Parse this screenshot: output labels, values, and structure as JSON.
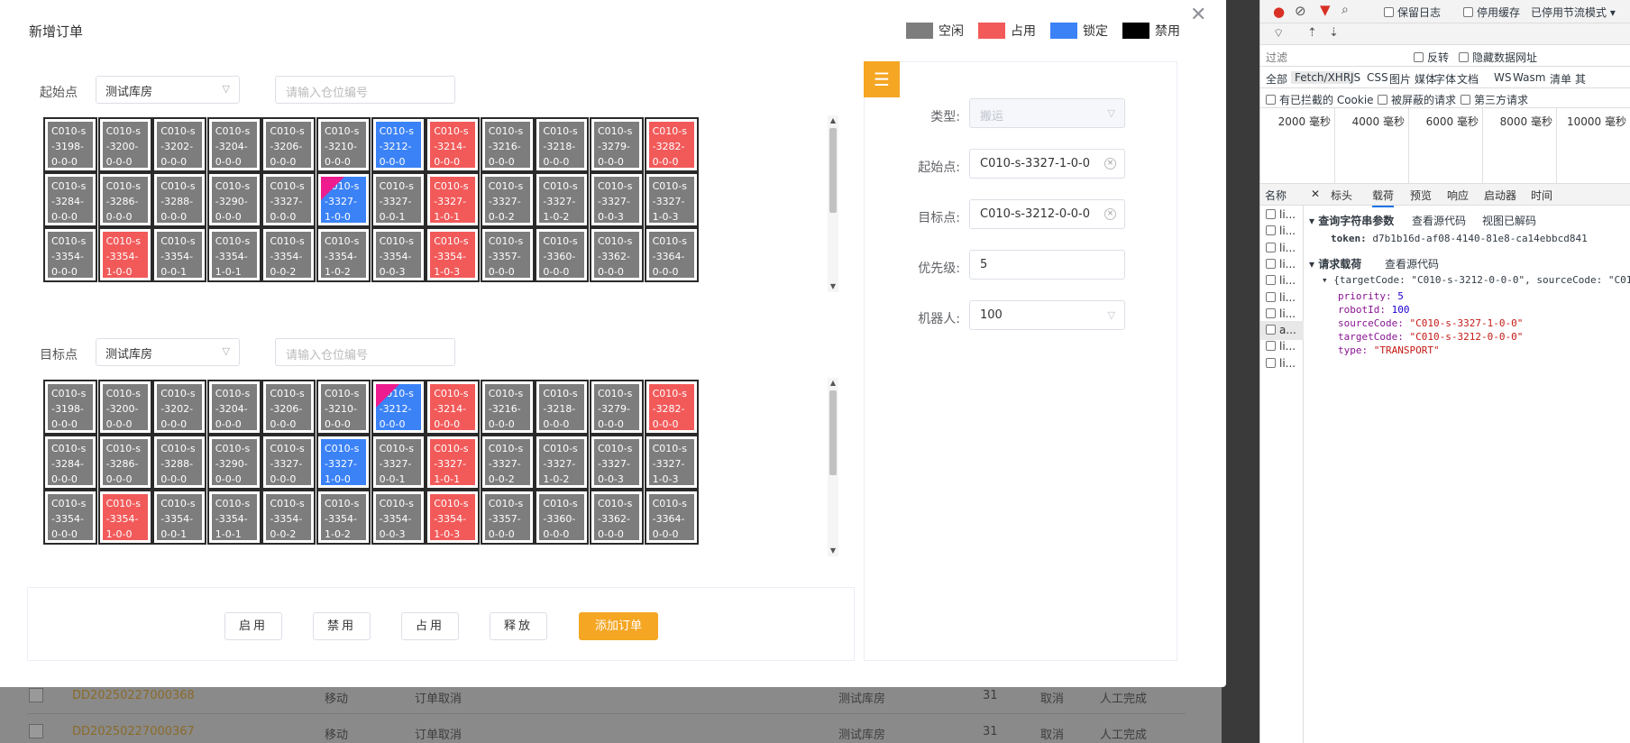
{
  "modal": {
    "title": "新增订单",
    "legend": [
      {
        "label": "空闲",
        "color": "#7d7d7d"
      },
      {
        "label": "占用",
        "color": "#f25a5a"
      },
      {
        "label": "锁定",
        "color": "#3b82f6"
      },
      {
        "label": "禁用",
        "color": "#000000"
      }
    ],
    "source": {
      "label": "起始点",
      "warehouse": "测试库房",
      "search_placeholder": "请输入仓位编号"
    },
    "target": {
      "label": "目标点",
      "warehouse": "测试库房",
      "search_placeholder": "请输入仓位编号"
    },
    "source_cells": [
      {
        "code": "C010-s-3198-0-0-0",
        "status": "free"
      },
      {
        "code": "C010-s-3200-0-0-0",
        "status": "free"
      },
      {
        "code": "C010-s-3202-0-0-0",
        "status": "free"
      },
      {
        "code": "C010-s-3204-0-0-0",
        "status": "free"
      },
      {
        "code": "C010-s-3206-0-0-0",
        "status": "free"
      },
      {
        "code": "C010-s-3210-0-0-0",
        "status": "free"
      },
      {
        "code": "C010-s-3212-0-0-0",
        "status": "lock"
      },
      {
        "code": "C010-s-3214-0-0-0",
        "status": "used"
      },
      {
        "code": "C010-s-3216-0-0-0",
        "status": "free"
      },
      {
        "code": "C010-s-3218-0-0-0",
        "status": "free"
      },
      {
        "code": "C010-s-3279-0-0-0",
        "status": "free"
      },
      {
        "code": "C010-s-3282-0-0-0",
        "status": "used"
      },
      {
        "code": "C010-s-3284-0-0-0",
        "status": "free"
      },
      {
        "code": "C010-s-3286-0-0-0",
        "status": "free"
      },
      {
        "code": "C010-s-3288-0-0-0",
        "status": "free"
      },
      {
        "code": "C010-s-3290-0-0-0",
        "status": "free"
      },
      {
        "code": "C010-s-3327-0-0-0",
        "status": "free"
      },
      {
        "code": "C010-s-3327-1-0-0",
        "status": "lock",
        "selected": true
      },
      {
        "code": "C010-s-3327-0-0-1",
        "status": "free"
      },
      {
        "code": "C010-s-3327-1-0-1",
        "status": "used"
      },
      {
        "code": "C010-s-3327-0-0-2",
        "status": "free"
      },
      {
        "code": "C010-s-3327-1-0-2",
        "status": "free"
      },
      {
        "code": "C010-s-3327-0-0-3",
        "status": "free"
      },
      {
        "code": "C010-s-3327-1-0-3",
        "status": "free"
      },
      {
        "code": "C010-s-3354-0-0-0",
        "status": "free"
      },
      {
        "code": "C010-s-3354-1-0-0",
        "status": "used"
      },
      {
        "code": "C010-s-3354-0-0-1",
        "status": "free"
      },
      {
        "code": "C010-s-3354-1-0-1",
        "status": "free"
      },
      {
        "code": "C010-s-3354-0-0-2",
        "status": "free"
      },
      {
        "code": "C010-s-3354-1-0-2",
        "status": "free"
      },
      {
        "code": "C010-s-3354-0-0-3",
        "status": "free"
      },
      {
        "code": "C010-s-3354-1-0-3",
        "status": "used"
      },
      {
        "code": "C010-s-3357-0-0-0",
        "status": "free"
      },
      {
        "code": "C010-s-3360-0-0-0",
        "status": "free"
      },
      {
        "code": "C010-s-3362-0-0-0",
        "status": "free"
      },
      {
        "code": "C010-s-3364-0-0-0",
        "status": "free"
      }
    ],
    "target_cells": [
      {
        "code": "C010-s-3198-0-0-0",
        "status": "free"
      },
      {
        "code": "C010-s-3200-0-0-0",
        "status": "free"
      },
      {
        "code": "C010-s-3202-0-0-0",
        "status": "free"
      },
      {
        "code": "C010-s-3204-0-0-0",
        "status": "free"
      },
      {
        "code": "C010-s-3206-0-0-0",
        "status": "free"
      },
      {
        "code": "C010-s-3210-0-0-0",
        "status": "free"
      },
      {
        "code": "C010-s-3212-0-0-0",
        "status": "lock",
        "selected": true
      },
      {
        "code": "C010-s-3214-0-0-0",
        "status": "used"
      },
      {
        "code": "C010-s-3216-0-0-0",
        "status": "free"
      },
      {
        "code": "C010-s-3218-0-0-0",
        "status": "free"
      },
      {
        "code": "C010-s-3279-0-0-0",
        "status": "free"
      },
      {
        "code": "C010-s-3282-0-0-0",
        "status": "used"
      },
      {
        "code": "C010-s-3284-0-0-0",
        "status": "free"
      },
      {
        "code": "C010-s-3286-0-0-0",
        "status": "free"
      },
      {
        "code": "C010-s-3288-0-0-0",
        "status": "free"
      },
      {
        "code": "C010-s-3290-0-0-0",
        "status": "free"
      },
      {
        "code": "C010-s-3327-0-0-0",
        "status": "free"
      },
      {
        "code": "C010-s-3327-1-0-0",
        "status": "lock"
      },
      {
        "code": "C010-s-3327-0-0-1",
        "status": "free"
      },
      {
        "code": "C010-s-3327-1-0-1",
        "status": "used"
      },
      {
        "code": "C010-s-3327-0-0-2",
        "status": "free"
      },
      {
        "code": "C010-s-3327-1-0-2",
        "status": "free"
      },
      {
        "code": "C010-s-3327-0-0-3",
        "status": "free"
      },
      {
        "code": "C010-s-3327-1-0-3",
        "status": "free"
      },
      {
        "code": "C010-s-3354-0-0-0",
        "status": "free"
      },
      {
        "code": "C010-s-3354-1-0-0",
        "status": "used"
      },
      {
        "code": "C010-s-3354-0-0-1",
        "status": "free"
      },
      {
        "code": "C010-s-3354-1-0-1",
        "status": "free"
      },
      {
        "code": "C010-s-3354-0-0-2",
        "status": "free"
      },
      {
        "code": "C010-s-3354-1-0-2",
        "status": "free"
      },
      {
        "code": "C010-s-3354-0-0-3",
        "status": "free"
      },
      {
        "code": "C010-s-3354-1-0-3",
        "status": "used"
      },
      {
        "code": "C010-s-3357-0-0-0",
        "status": "free"
      },
      {
        "code": "C010-s-3360-0-0-0",
        "status": "free"
      },
      {
        "code": "C010-s-3362-0-0-0",
        "status": "free"
      },
      {
        "code": "C010-s-3364-0-0-0",
        "status": "free"
      }
    ],
    "buttons": {
      "enable": "启用",
      "disable": "禁用",
      "occupy": "占用",
      "release": "释放",
      "add_order": "添加订单"
    },
    "form": {
      "type_label": "类型:",
      "type_value": "搬运",
      "source_label": "起始点:",
      "source_value": "C010-s-3327-1-0-0",
      "target_label": "目标点:",
      "target_value": "C010-s-3212-0-0-0",
      "priority_label": "优先级:",
      "priority_value": "5",
      "robot_label": "机器人:",
      "robot_value": "100"
    }
  },
  "background_rows": [
    {
      "code": "DD20250227000368",
      "type": "移动",
      "status": "订单取消",
      "warehouse": "测试库房",
      "num": "31",
      "action1": "取消",
      "action2": "人工完成"
    },
    {
      "code": "DD20250227000367",
      "type": "移动",
      "status": "订单取消",
      "warehouse": "测试库房",
      "num": "31",
      "action1": "取消",
      "action2": "人工完成"
    }
  ],
  "devtools": {
    "toolbar": {
      "preserve_log": "保留日志",
      "disable_cache": "停用缓存",
      "throttle": "已停用节流模式"
    },
    "filter": {
      "placeholder": "过滤",
      "invert": "反转",
      "hide_data_urls": "隐藏数据网址"
    },
    "type_filters": [
      "全部",
      "Fetch/XHR",
      "JS",
      "CSS",
      "图片",
      "媒体",
      "字体",
      "文档",
      "WS",
      "Wasm",
      "清单",
      "其"
    ],
    "extra_filters": {
      "blocked_cookies": "有已拦截的 Cookie",
      "blocked_requests": "被屏蔽的请求",
      "third_party": "第三方请求"
    },
    "timeline_ticks": [
      "2000 毫秒",
      "4000 毫秒",
      "6000 毫秒",
      "8000 毫秒",
      "10000 毫秒"
    ],
    "name_header": "名称",
    "requests": [
      "li...",
      "li...",
      "li...",
      "li...",
      "li...",
      "li...",
      "li...",
      "a...",
      "li...",
      "li..."
    ],
    "detail_tabs": [
      "标头",
      "载荷",
      "预览",
      "响应",
      "启动器",
      "时间"
    ],
    "query_section": "查询字符串参数",
    "view_source": "查看源代码",
    "view_decoded": "视图已解码",
    "token_key": "token:",
    "token_value": "d7b1b16d-af08-4140-81e8-ca14ebbcd841",
    "payload_section": "请求载荷",
    "payload_view_source": "查看源代码",
    "payload_summary": "{targetCode: \"C010-s-3212-0-0-0\", sourceCode: \"C010",
    "payload": [
      {
        "key": "priority:",
        "value": "5",
        "kind": "num"
      },
      {
        "key": "robotId:",
        "value": "100",
        "kind": "num"
      },
      {
        "key": "sourceCode:",
        "value": "\"C010-s-3327-1-0-0\"",
        "kind": "str"
      },
      {
        "key": "targetCode:",
        "value": "\"C010-s-3212-0-0-0\"",
        "kind": "str"
      },
      {
        "key": "type:",
        "value": "\"TRANSPORT\"",
        "kind": "str"
      }
    ]
  }
}
